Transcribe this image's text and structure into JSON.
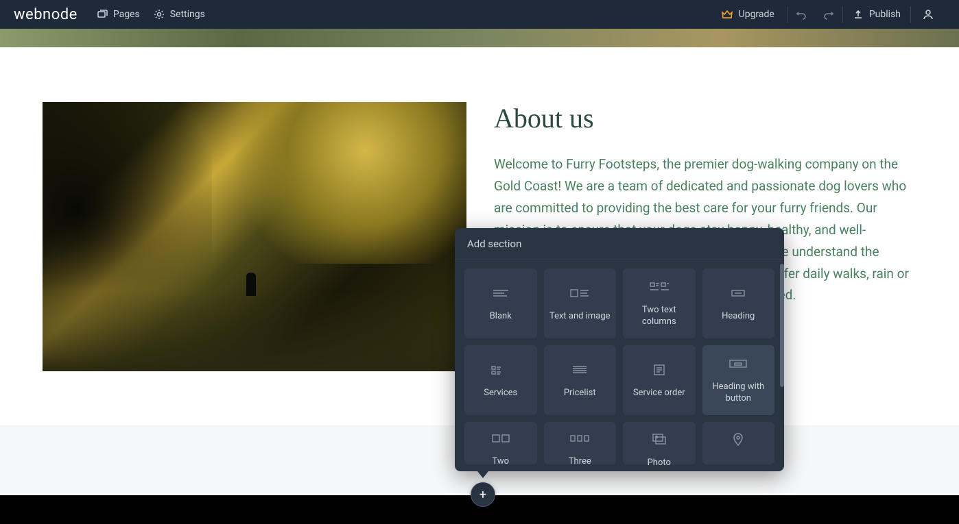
{
  "brand": "webnode",
  "nav": {
    "pages": "Pages",
    "settings": "Settings"
  },
  "actions": {
    "upgrade": "Upgrade",
    "publish": "Publish"
  },
  "about": {
    "heading": "About us",
    "body": "Welcome to Furry Footsteps, the premier dog-walking company on the Gold Coast! We are a team of dedicated and passionate dog lovers who are committed to providing the best care for your furry friends. Our mission is to ensure that your dogs stay happy, healthy, and well-exercised while you're away. At Furry Footsteps, we understand the importance of regular exercise for your dog. We offer daily walks, rain or shine, to keep your dog active, healthy, and engaged."
  },
  "popover": {
    "title": "Add section",
    "items": [
      {
        "label": "Blank"
      },
      {
        "label": "Text and image"
      },
      {
        "label": "Two text columns"
      },
      {
        "label": "Heading"
      },
      {
        "label": "Services"
      },
      {
        "label": "Pricelist"
      },
      {
        "label": "Service order"
      },
      {
        "label": "Heading with button"
      },
      {
        "label": "Two"
      },
      {
        "label": "Three"
      },
      {
        "label": "Photo"
      },
      {
        "label": ""
      }
    ]
  },
  "addBtn": "+"
}
